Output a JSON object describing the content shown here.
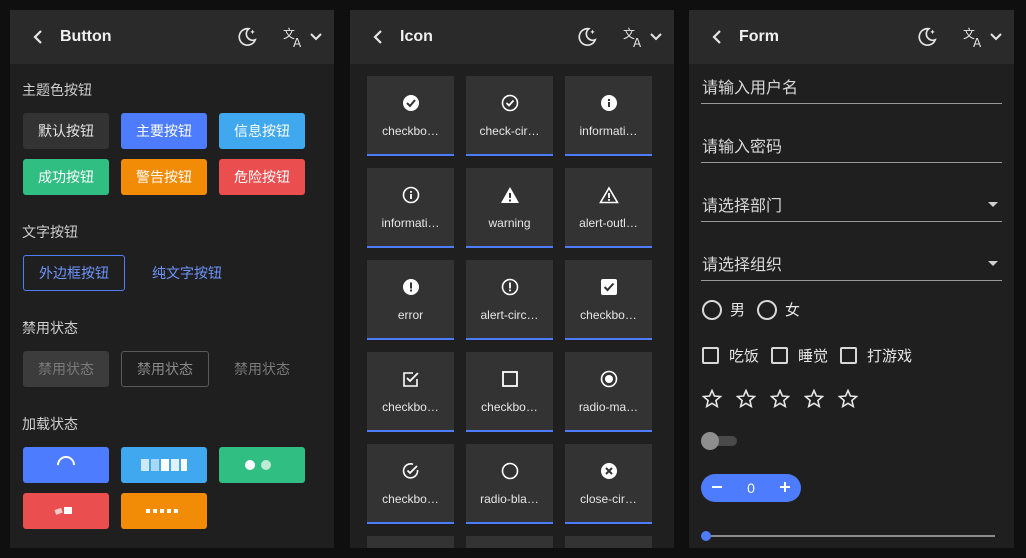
{
  "panels": {
    "button": {
      "title": "Button",
      "sections": {
        "theme": "主题色按钮",
        "text": "文字按钮",
        "disabled": "禁用状态",
        "loading": "加载状态"
      },
      "theme_buttons": [
        "默认按钮",
        "主要按钮",
        "信息按钮",
        "成功按钮",
        "警告按钮",
        "危险按钮"
      ],
      "text_buttons": [
        "外边框按钮",
        "纯文字按钮"
      ],
      "disabled_buttons": [
        "禁用状态",
        "禁用状态",
        "禁用状态"
      ]
    },
    "icon": {
      "title": "Icon",
      "items": [
        {
          "label": "checkbo…",
          "icon": "check-circle-filled-icon"
        },
        {
          "label": "check-cir…",
          "icon": "check-circle-outline-icon"
        },
        {
          "label": "informati…",
          "icon": "information-filled-icon"
        },
        {
          "label": "informati…",
          "icon": "information-outline-icon"
        },
        {
          "label": "warning",
          "icon": "warning-icon"
        },
        {
          "label": "alert-outl…",
          "icon": "alert-outline-icon"
        },
        {
          "label": "error",
          "icon": "error-icon"
        },
        {
          "label": "alert-circ…",
          "icon": "alert-circle-outline-icon"
        },
        {
          "label": "checkbo…",
          "icon": "checkbox-marked-icon"
        },
        {
          "label": "checkbo…",
          "icon": "checkbox-marked-outline-icon"
        },
        {
          "label": "checkbo…",
          "icon": "checkbox-blank-outline-icon"
        },
        {
          "label": "radio-ma…",
          "icon": "radio-marked-icon"
        },
        {
          "label": "checkbo…",
          "icon": "checkbox-marked-circle-outline-icon"
        },
        {
          "label": "radio-bla…",
          "icon": "radio-blank-icon"
        },
        {
          "label": "close-cir…",
          "icon": "close-circle-icon"
        }
      ]
    },
    "form": {
      "title": "Form",
      "username_placeholder": "请输入用户名",
      "password_placeholder": "请输入密码",
      "department_placeholder": "请选择部门",
      "organization_placeholder": "请选择组织",
      "gender_options": [
        "男",
        "女"
      ],
      "hobby_options": [
        "吃饭",
        "睡觉",
        "打游戏"
      ],
      "rating": {
        "value": 0,
        "max": 5
      },
      "switch_on": false,
      "stepper_value": "0",
      "slider_value": 0
    }
  },
  "colors": {
    "primary": "#4d7cfe",
    "info": "#3fa8ee",
    "success": "#31be82",
    "warning": "#f28b06",
    "danger": "#ea4e4f"
  }
}
